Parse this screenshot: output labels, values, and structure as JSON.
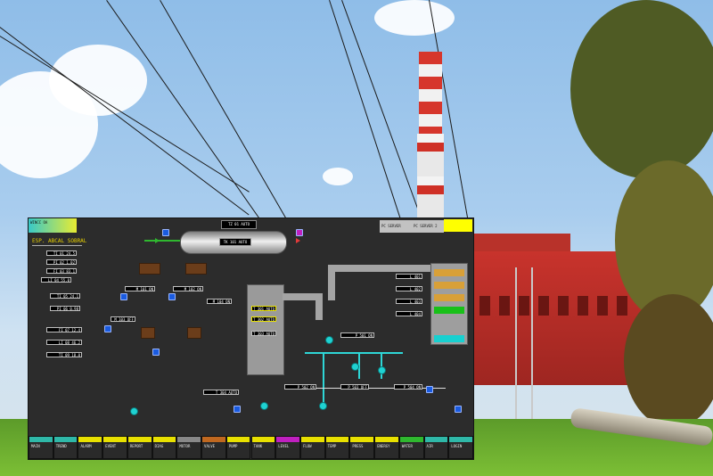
{
  "hmi": {
    "logo_text": "WINCC OA",
    "title": "ESP. ABCAL SOBRAL",
    "header": {
      "center_tag": "TZ 01 AUTO",
      "right_box_1": "PC SERVER",
      "right_box_2": "PC SERVER 2"
    },
    "tank_tag": "TK 101 AUTO",
    "left_tags": [
      "TI 01  24.5",
      "PI 02  1.02",
      "FI 03  83.1",
      "LI 04  55.0",
      "TI 05  24.1",
      "PI 06  0.98",
      "FI 07  12.4",
      "LI 08  46.2",
      "TI 09  18.0"
    ],
    "mid_tags": [
      "M 101  ON",
      "M 102  ON",
      "M 103  OFF",
      "M 104  ON"
    ],
    "column_tags": [
      "T 301 AUTO",
      "T 302 AUTO",
      "T 303 AUTO",
      "T 304 AUTO"
    ],
    "vessel_tags": [
      "L 401",
      "L 402",
      "L 403",
      "L 404"
    ],
    "pump_tags": [
      "P 501 ON",
      "P 502 ON",
      "P 503 OFF",
      "P 504 ON"
    ],
    "footer_buttons": [
      "MAIN",
      "TREND",
      "ALARM",
      "EVENT",
      "REPORT",
      "DIAG",
      "MOTOR",
      "VALVE",
      "PUMP",
      "TANK",
      "LEVEL",
      "FLOW",
      "TEMP",
      "PRESS",
      "ENERGY",
      "WATER",
      "AIR",
      "LOGIN"
    ],
    "colors": {
      "panel_bg": "#2c2c2c",
      "accent_yellow": "#ffff00",
      "motor_cyan": "#1fd2d2",
      "control_blue": "#1a5be0",
      "hopper_brown": "#6b3d1a"
    },
    "icons": [
      "motor-icon",
      "valve-icon",
      "hopper-icon",
      "control-button-icon"
    ]
  }
}
